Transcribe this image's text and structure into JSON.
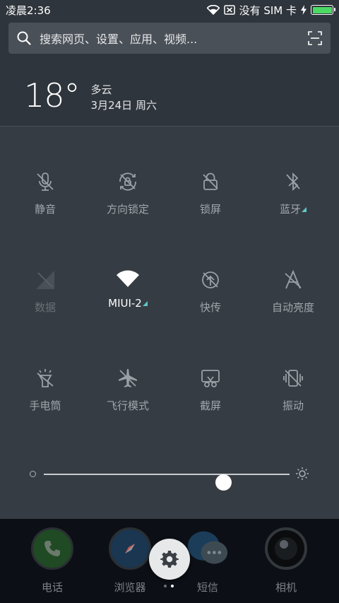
{
  "status": {
    "time": "凌晨2:36",
    "sim": "没有 SIM 卡",
    "battery_level": 1.0
  },
  "search": {
    "placeholder": "搜索网页、设置、应用、视频..."
  },
  "weather": {
    "temperature": "18°",
    "condition": "多云",
    "date": "3月24日 周六"
  },
  "toggles": [
    {
      "label": "静音",
      "icon": "mic-off-icon",
      "state": "off"
    },
    {
      "label": "方向锁定",
      "icon": "rotation-lock-icon",
      "state": "off"
    },
    {
      "label": "锁屏",
      "icon": "lock-screen-icon",
      "state": "off"
    },
    {
      "label": "蓝牙",
      "icon": "bluetooth-off-icon",
      "state": "off"
    },
    {
      "label": "数据",
      "icon": "mobile-data-icon",
      "state": "disabled"
    },
    {
      "label": "MIUI-2",
      "icon": "wifi-icon",
      "state": "on"
    },
    {
      "label": "快传",
      "icon": "quick-transfer-icon",
      "state": "off"
    },
    {
      "label": "自动亮度",
      "icon": "auto-brightness-icon",
      "state": "off"
    },
    {
      "label": "手电筒",
      "icon": "flashlight-icon",
      "state": "off"
    },
    {
      "label": "飞行模式",
      "icon": "airplane-icon",
      "state": "off"
    },
    {
      "label": "截屏",
      "icon": "screenshot-icon",
      "state": "off"
    },
    {
      "label": "振动",
      "icon": "vibrate-icon",
      "state": "off"
    }
  ],
  "brightness": {
    "level": 0.73
  },
  "dock": {
    "apps": [
      {
        "label": "电话",
        "icon": "phone-icon"
      },
      {
        "label": "浏览器",
        "icon": "browser-icon"
      },
      {
        "label": "短信",
        "icon": "messages-icon"
      },
      {
        "label": "相机",
        "icon": "camera-icon"
      }
    ],
    "page_count": 2,
    "current_page": 1
  },
  "colors": {
    "accent": "#5ec7c7",
    "battery": "#4cd964"
  }
}
